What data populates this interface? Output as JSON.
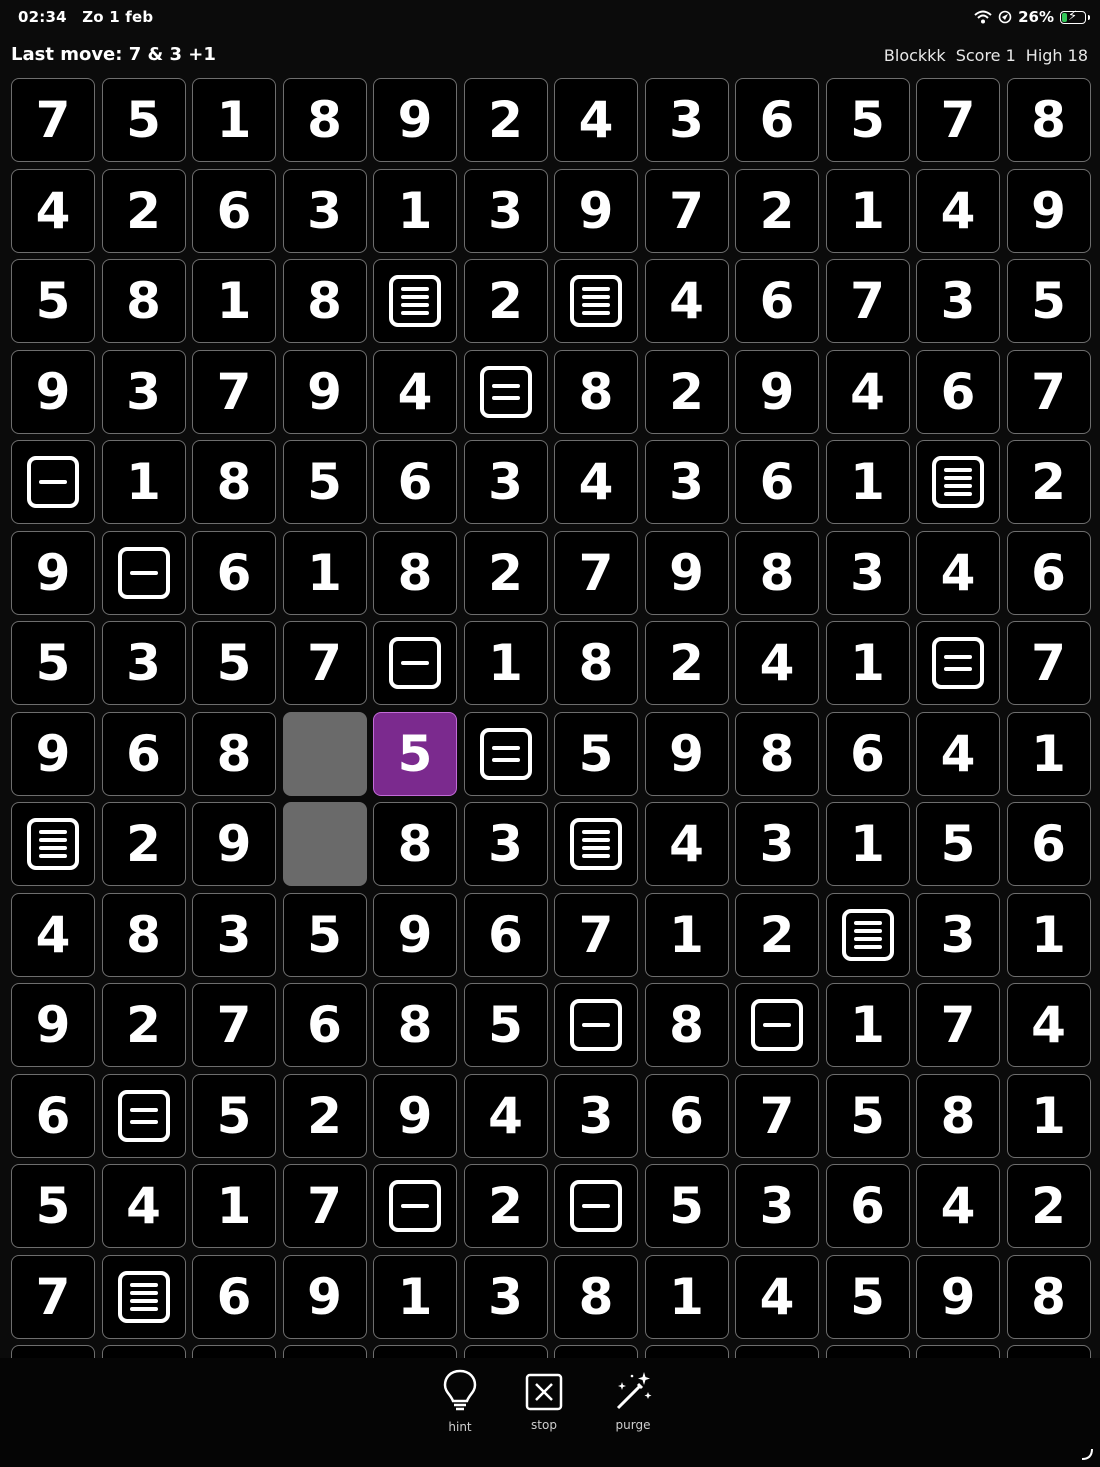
{
  "status": {
    "time": "02:34",
    "date": "Zo 1 feb",
    "battery": "26%",
    "battery_level": 0.26,
    "icons": [
      "wifi-icon",
      "location-icon",
      "battery-icon"
    ]
  },
  "header": {
    "last_move": "Last move: 7 & 3  +1",
    "app_name": "Blockkk",
    "score": "Score 1",
    "high": "High 18"
  },
  "colors": {
    "background": "#0b0b0b",
    "selected": "#7b2a8e",
    "empty": "#6a6a6a",
    "cell_border": "#6e6e6e"
  },
  "legend": {
    "L": "lines-icon (four horizontal lines in a box)",
    "E": "equals-icon (two horizontal lines in a box)",
    "M": "minus-icon (single horizontal line in a box)",
    "_": "empty cell",
    "*": "selected cell"
  },
  "grid": [
    [
      "7",
      "5",
      "1",
      "8",
      "9",
      "2",
      "4",
      "3",
      "6",
      "5",
      "7",
      "8"
    ],
    [
      "4",
      "2",
      "6",
      "3",
      "1",
      "3",
      "9",
      "7",
      "2",
      "1",
      "4",
      "9"
    ],
    [
      "5",
      "8",
      "1",
      "8",
      "L",
      "2",
      "L",
      "4",
      "6",
      "7",
      "3",
      "5"
    ],
    [
      "9",
      "3",
      "7",
      "9",
      "4",
      "E",
      "8",
      "2",
      "9",
      "4",
      "6",
      "7"
    ],
    [
      "M",
      "1",
      "8",
      "5",
      "6",
      "3",
      "4",
      "3",
      "6",
      "1",
      "L",
      "2"
    ],
    [
      "9",
      "M",
      "6",
      "1",
      "8",
      "2",
      "7",
      "9",
      "8",
      "3",
      "4",
      "6"
    ],
    [
      "5",
      "3",
      "5",
      "7",
      "M",
      "1",
      "8",
      "2",
      "4",
      "1",
      "E",
      "7"
    ],
    [
      "9",
      "6",
      "8",
      "_",
      "*5",
      "E",
      "5",
      "9",
      "8",
      "6",
      "4",
      "1"
    ],
    [
      "L",
      "2",
      "9",
      "_",
      "8",
      "3",
      "L",
      "4",
      "3",
      "1",
      "5",
      "6"
    ],
    [
      "4",
      "8",
      "3",
      "5",
      "9",
      "6",
      "7",
      "1",
      "2",
      "L",
      "3",
      "1"
    ],
    [
      "9",
      "2",
      "7",
      "6",
      "8",
      "5",
      "M",
      "8",
      "M",
      "1",
      "7",
      "4"
    ],
    [
      "6",
      "E",
      "5",
      "2",
      "9",
      "4",
      "3",
      "6",
      "7",
      "5",
      "8",
      "1"
    ],
    [
      "5",
      "4",
      "1",
      "7",
      "M",
      "2",
      "M",
      "5",
      "3",
      "6",
      "4",
      "2"
    ],
    [
      "7",
      "L",
      "6",
      "9",
      "1",
      "3",
      "8",
      "1",
      "4",
      "5",
      "9",
      "8"
    ],
    [
      "",
      "",
      "",
      "",
      "",
      "",
      "",
      "",
      "",
      "",
      "",
      ""
    ]
  ],
  "toolbar": {
    "hint_label": "hint",
    "stop_label": "stop",
    "purge_label": "purge"
  }
}
